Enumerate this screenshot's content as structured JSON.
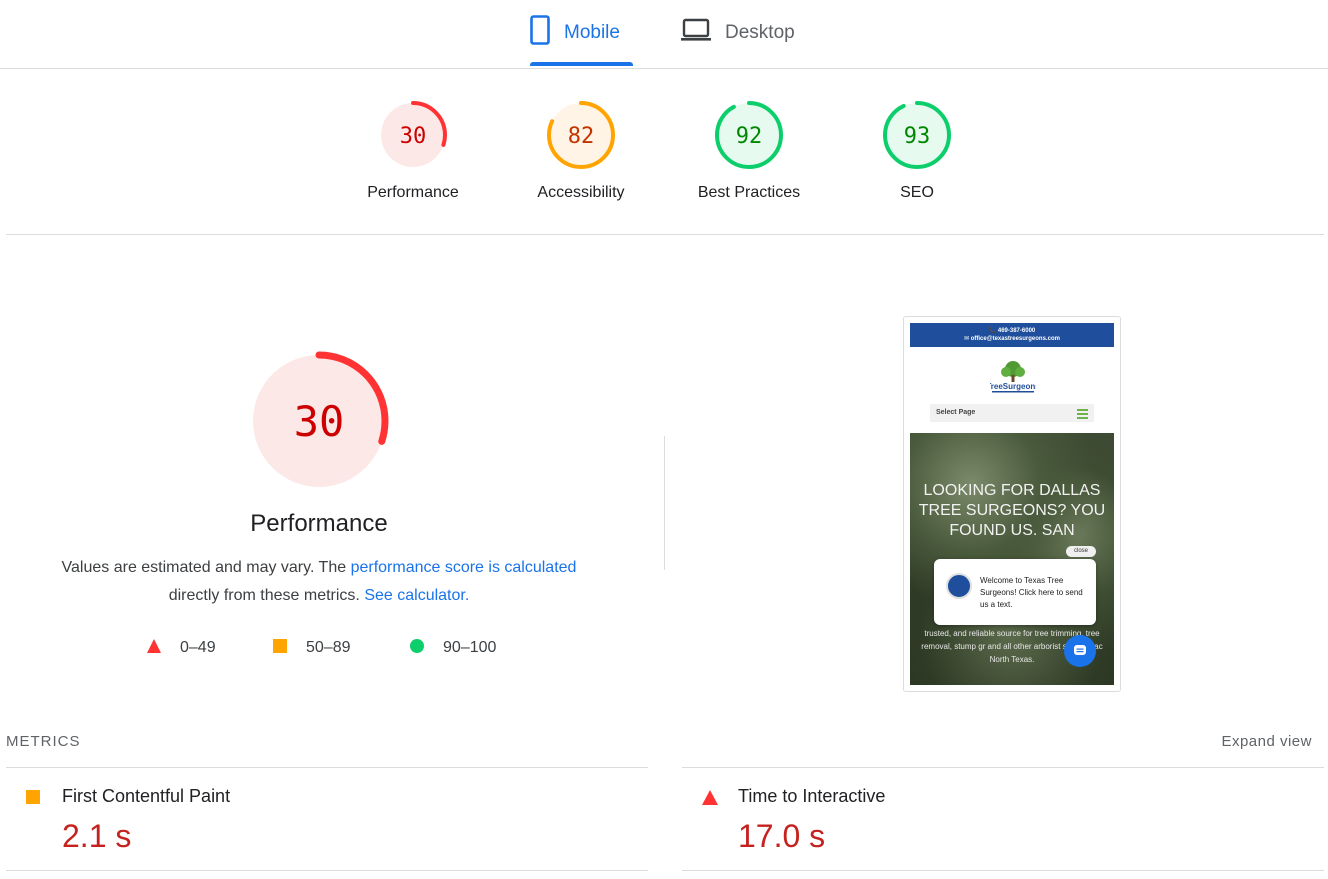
{
  "tabs": {
    "mobile": "Mobile",
    "desktop": "Desktop",
    "active": "mobile"
  },
  "scores": [
    {
      "name": "Performance",
      "value": "30",
      "fraction": 0.3,
      "color": "#ff3333",
      "bg": "#fde8e8",
      "text": "#c00"
    },
    {
      "name": "Accessibility",
      "value": "82",
      "fraction": 0.82,
      "color": "#ffa400",
      "bg": "#fff4e5",
      "text": "#c33300"
    },
    {
      "name": "Best Practices",
      "value": "92",
      "fraction": 0.92,
      "color": "#0cce6b",
      "bg": "#e6faf0",
      "text": "#080"
    },
    {
      "name": "SEO",
      "value": "93",
      "fraction": 0.93,
      "color": "#0cce6b",
      "bg": "#e6faf0",
      "text": "#080"
    }
  ],
  "performance": {
    "score": "30",
    "fraction": 0.3,
    "title": "Performance",
    "desc_pre": "Values are estimated and may vary. The ",
    "desc_link1": "performance score is calculated",
    "desc_mid": " directly from these metrics. ",
    "desc_link2": "See calculator."
  },
  "legend": [
    {
      "shape": "triangle",
      "label": "0–49",
      "color": "#ff3333"
    },
    {
      "shape": "square",
      "label": "50–89",
      "color": "#ffa400"
    },
    {
      "shape": "circle",
      "label": "90–100",
      "color": "#0cce6b"
    }
  ],
  "screenshot": {
    "phone": "📞 469-387-6000",
    "email": "✉ office@texastreesurgeons.com",
    "logo_text": "TreeSurgeons",
    "select_page": "Select Page",
    "hero": "LOOKING FOR DALLAS TREE SURGEONS? YOU FOUND US. SAN",
    "hero_small": "trusted, and reliable source for tree trimming, tree removal, stump gr and all other arborist services ac North Texas.",
    "close": "close",
    "bubble": "Welcome to Texas Tree Surgeons! Click here to send us a text."
  },
  "metrics": {
    "header": "METRICS",
    "expand": "Expand view",
    "items": [
      {
        "name": "First Contentful Paint",
        "value": "2.1 s",
        "status": "average"
      },
      {
        "name": "Time to Interactive",
        "value": "17.0 s",
        "status": "fail"
      }
    ]
  }
}
